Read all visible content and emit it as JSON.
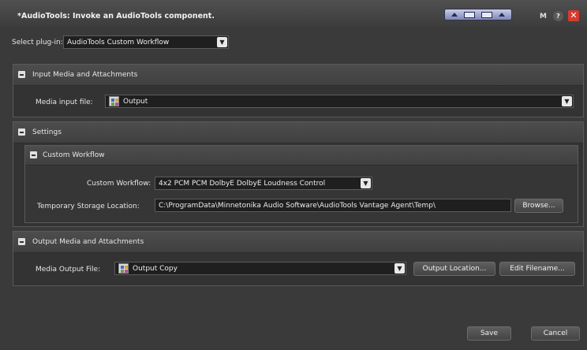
{
  "window": {
    "title": "*AudioTools: Invoke an AudioTools component.",
    "m_label": "M",
    "help_label": "?",
    "close_label": "✕"
  },
  "plugin": {
    "label": "Select plug-in:",
    "value": "AudioTools Custom Workflow"
  },
  "input_section": {
    "title": "Input Media and Attachments",
    "media_label": "Media input file:",
    "media_value": "Output"
  },
  "settings_section": {
    "title": "Settings",
    "custom_workflow_group": {
      "title": "Custom Workflow",
      "workflow_label": "Custom Workflow:",
      "workflow_value": "4x2 PCM PCM DolbyE DolbyE Loudness Control",
      "storage_label": "Temporary Storage Location:",
      "storage_value": "C:\\ProgramData\\Minnetonika Audio Software\\AudioTools Vantage Agent\\Temp\\",
      "browse_label": "Browse..."
    }
  },
  "output_section": {
    "title": "Output Media and Attachments",
    "media_label": "Media Output File:",
    "media_value": "Output Copy",
    "output_location_label": "Output Location...",
    "edit_filename_label": "Edit Filename..."
  },
  "footer": {
    "save_label": "Save",
    "cancel_label": "Cancel"
  },
  "colors": {
    "background": "#3a3a3a",
    "close_button": "#d73a2e",
    "view_controls": "#9aa1cc"
  }
}
